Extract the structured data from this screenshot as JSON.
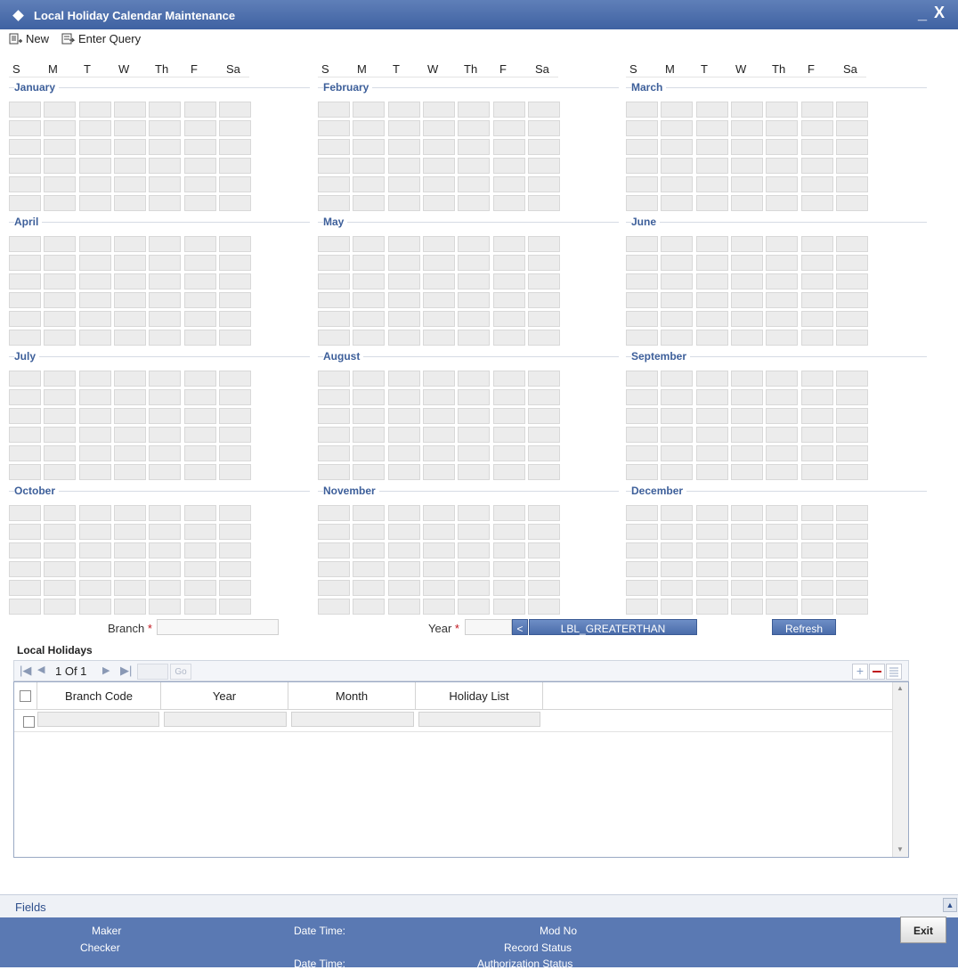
{
  "window": {
    "title": "Local Holiday Calendar Maintenance",
    "minimize": "_",
    "close": "X"
  },
  "toolbar": {
    "new_label": "New",
    "enter_query_label": "Enter Query"
  },
  "day_headers": [
    "S",
    "M",
    "T",
    "W",
    "Th",
    "F",
    "Sa"
  ],
  "months": [
    "January",
    "February",
    "March",
    "April",
    "May",
    "June",
    "July",
    "August",
    "September",
    "October",
    "November",
    "December"
  ],
  "form": {
    "branch_label": "Branch",
    "year_label": "Year",
    "required_mark": "*",
    "prev_button": "<",
    "next_button": "LBL_GREATERTHAN",
    "refresh_button": "Refresh"
  },
  "local_holidays": {
    "title": "Local Holidays",
    "pager_text": "1 Of 1",
    "go_label": "Go",
    "columns": [
      "Branch Code",
      "Year",
      "Month",
      "Holiday List"
    ]
  },
  "fields_label": "Fields",
  "footer": {
    "maker": "Maker",
    "checker": "Checker",
    "date_time_1": "Date Time:",
    "date_time_2": "Date Time:",
    "mod_no": "Mod No",
    "record_status": "Record Status",
    "authorization_status": "Authorization Status",
    "exit": "Exit"
  },
  "colors": {
    "title_bar": "#4a6caa",
    "month_label": "#3d5f9a",
    "footer": "#5a79b3",
    "required": "#c0141c"
  }
}
